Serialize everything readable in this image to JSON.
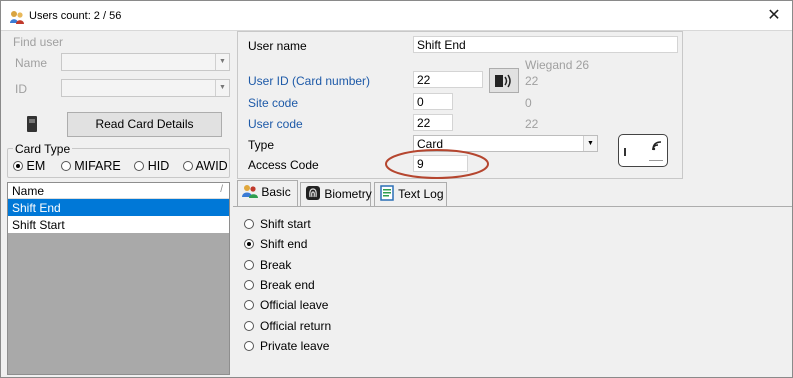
{
  "window": {
    "title": "Users count: 2 / 56",
    "close": "✕"
  },
  "find_user": {
    "label": "Find user",
    "name_label": "Name",
    "id_label": "ID",
    "name_value": "",
    "id_value": ""
  },
  "read_card": {
    "button": "Read Card Details"
  },
  "card_type": {
    "label": "Card Type",
    "options": [
      "EM",
      "MIFARE",
      "HID",
      "AWID"
    ],
    "selected": "EM"
  },
  "user_list": {
    "header": "Name",
    "sort_glyph": "/",
    "rows": [
      {
        "name": "Shift End",
        "selected": true
      },
      {
        "name": "Shift Start",
        "selected": false
      }
    ]
  },
  "details": {
    "user_name_label": "User name",
    "user_name_value": "Shift End",
    "wiegand_label": "Wiegand 26",
    "user_id_label": "User ID (Card number)",
    "user_id_value": "22",
    "user_id_wiegand": "22",
    "site_code_label": "Site code",
    "site_code_value": "0",
    "site_code_wiegand": "0",
    "user_code_label": "User code",
    "user_code_value": "22",
    "user_code_wiegand": "22",
    "type_label": "Type",
    "type_value": "Card",
    "access_code_label": "Access Code",
    "access_code_value": "9"
  },
  "tabs": [
    {
      "label": "Basic",
      "icon": "users-icon",
      "active": true
    },
    {
      "label": "Biometry",
      "icon": "fingerprint-icon",
      "active": false
    },
    {
      "label": "Text Log",
      "icon": "document-icon",
      "active": false
    }
  ],
  "basic_options": [
    {
      "label": "Shift start",
      "checked": false
    },
    {
      "label": "Shift end",
      "checked": true
    },
    {
      "label": "Break",
      "checked": false
    },
    {
      "label": "Break end",
      "checked": false
    },
    {
      "label": "Official leave",
      "checked": false
    },
    {
      "label": "Official return",
      "checked": false
    },
    {
      "label": "Private leave",
      "checked": false
    }
  ],
  "colors": {
    "selection": "#0078d7",
    "list_background": "#a9a9a9",
    "link_blue": "#1e5aa8",
    "annotation": "#b5462f"
  }
}
